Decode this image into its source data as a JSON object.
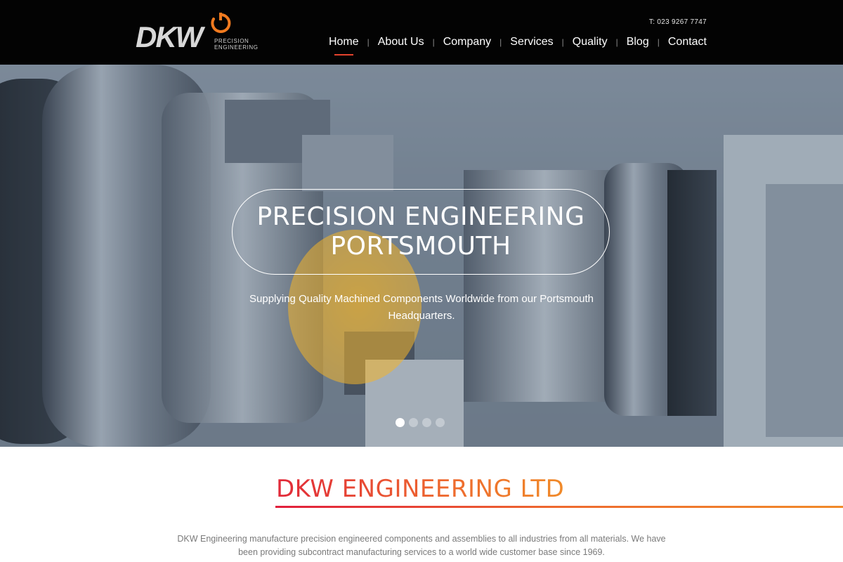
{
  "header": {
    "logo": {
      "brand": "DKW",
      "sub_line1": "PRECISION",
      "sub_line2": "ENGINEERING"
    },
    "phone": "T: 023 9267 7747",
    "nav": [
      {
        "label": "Home",
        "active": true
      },
      {
        "label": "About Us"
      },
      {
        "label": "Company"
      },
      {
        "label": "Services"
      },
      {
        "label": "Quality"
      },
      {
        "label": "Blog"
      },
      {
        "label": "Contact"
      }
    ],
    "nav_separator": "|"
  },
  "hero": {
    "title_line1": "PRECISION ENGINEERING",
    "title_line2": "PORTSMOUTH",
    "subtitle": "Supplying Quality Machined Components Worldwide from our Portsmouth Headquarters.",
    "slides_total": 4,
    "active_slide": 1
  },
  "content": {
    "title": "DKW ENGINEERING LTD",
    "intro": "DKW Engineering manufacture precision engineered components and assemblies to all industries from all materials. We have been providing subcontract manufacturing services to a world wide customer base since 1969."
  },
  "colors": {
    "header_bg": "#030303",
    "accent": "#e4432d",
    "logo_ring": "#f07a1f",
    "title_gradient_start": "#e12a3a",
    "title_gradient_end": "#f08a2a"
  }
}
